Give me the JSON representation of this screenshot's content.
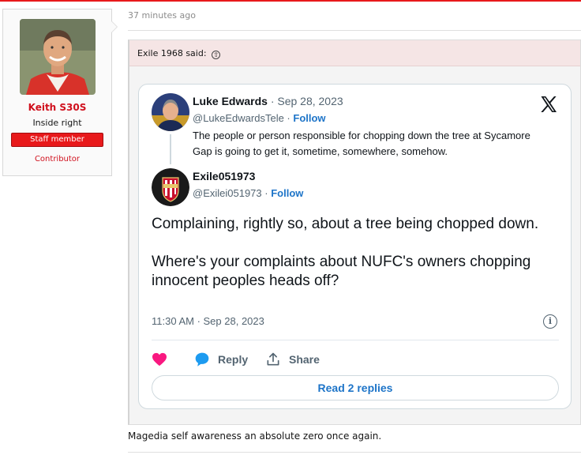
{
  "post": {
    "timestamp": "37 minutes ago",
    "body": "Magedia self awareness an absolute zero once again."
  },
  "user": {
    "name": "Keith S30S",
    "title": "Inside right",
    "badge": "Staff member",
    "role": "Contributor"
  },
  "quote": {
    "author": "Exile 1968 said:",
    "arrow": "⇧"
  },
  "tweet": {
    "quoted": {
      "name": "Luke Edwards",
      "date": "· Sep 28, 2023",
      "handle": "@LukeEdwardsTele ·",
      "follow": "Follow",
      "text": "The people or person responsible for chopping down the tree at Sycamore Gap is going to get it, sometime, somewhere, somehow."
    },
    "author": {
      "name": "Exile051973",
      "handle": "@Exilei051973 ·",
      "follow": "Follow"
    },
    "text_p1": "Complaining, rightly so, about a tree being chopped down.",
    "text_p2": "Where's your complaints about NUFC's owners chopping innocent peoples heads off?",
    "time": "11:30 AM · Sep 28, 2023",
    "info_symbol": "i",
    "actions": {
      "reply": "Reply",
      "share": "Share"
    },
    "read_replies": "Read 2 replies"
  },
  "colors": {
    "brand_red": "#e8191b",
    "link_blue": "#1d74c8",
    "like_pink": "#f91880",
    "reply_blue": "#1d9bf0"
  }
}
